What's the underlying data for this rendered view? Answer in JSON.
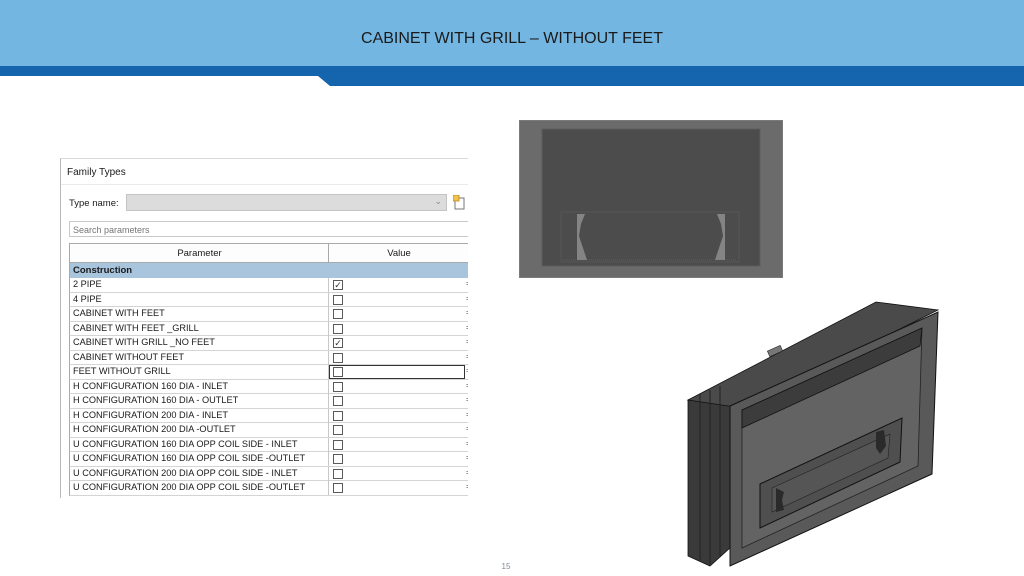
{
  "slide": {
    "title": "CABINET WITH GRILL – WITHOUT FEET",
    "page_number": "15",
    "colors": {
      "header": "#74b6e2",
      "stripe": "#1464ae",
      "group_row": "#a9c4dd"
    }
  },
  "dialog": {
    "title": "Family Types",
    "type_name_label": "Type name:",
    "type_name_value": "",
    "search_placeholder": "Search parameters",
    "columns": {
      "parameter": "Parameter",
      "value": "Value"
    },
    "group": "Construction",
    "rows": [
      {
        "name": "2 PIPE",
        "checked": true
      },
      {
        "name": "4 PIPE",
        "checked": false
      },
      {
        "name": "CABINET WITH FEET",
        "checked": false
      },
      {
        "name": "CABINET WITH FEET _GRILL",
        "checked": false
      },
      {
        "name": "CABINET WITH GRILL _NO FEET",
        "checked": true
      },
      {
        "name": "CABINET WITHOUT FEET",
        "checked": false
      },
      {
        "name": "FEET WITHOUT GRILL",
        "checked": false,
        "selected": true
      },
      {
        "name": "H CONFIGURATION 160 DIA - INLET",
        "checked": false
      },
      {
        "name": "H CONFIGURATION 160 DIA - OUTLET",
        "checked": false
      },
      {
        "name": "H CONFIGURATION 200 DIA - INLET",
        "checked": false
      },
      {
        "name": "H CONFIGURATION 200 DIA -OUTLET",
        "checked": false
      },
      {
        "name": "U CONFIGURATION 160 DIA OPP COIL SIDE - INLET",
        "checked": false
      },
      {
        "name": "U CONFIGURATION 160 DIA OPP  COIL SIDE -OUTLET",
        "checked": false
      },
      {
        "name": "U CONFIGURATION 200 DIA OPP COIL SIDE - INLET",
        "checked": false
      },
      {
        "name": "U CONFIGURATION 200 DIA OPP COIL SIDE -OUTLET",
        "checked": false
      }
    ]
  }
}
